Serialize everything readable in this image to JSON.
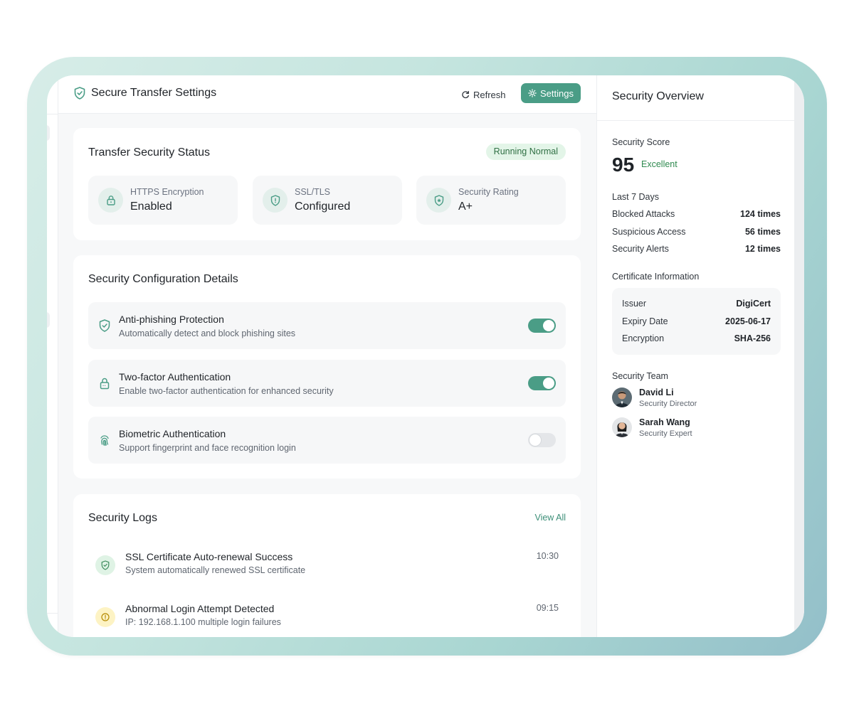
{
  "topbar": {
    "title": "Secure Transfer Settings",
    "refresh_label": "Refresh",
    "settings_label": "Settings"
  },
  "status": {
    "title": "Transfer Security Status",
    "badge": "Running Normal",
    "stats": [
      {
        "label": "HTTPS Encryption",
        "value": "Enabled",
        "icon": "lock-icon"
      },
      {
        "label": "SSL/TLS",
        "value": "Configured",
        "icon": "shield-check-icon"
      },
      {
        "label": "Security Rating",
        "value": "A+",
        "icon": "shield-star-icon"
      }
    ]
  },
  "config": {
    "title": "Security Configuration Details",
    "items": [
      {
        "name": "Anti-phishing Protection",
        "desc": "Automatically detect and block phishing sites",
        "enabled": true,
        "icon": "shield-icon"
      },
      {
        "name": "Two-factor Authentication",
        "desc": "Enable two-factor authentication for enhanced security",
        "enabled": true,
        "icon": "lock-icon"
      },
      {
        "name": "Biometric Authentication",
        "desc": "Support fingerprint and face recognition login",
        "enabled": false,
        "icon": "fingerprint-icon"
      }
    ]
  },
  "logs": {
    "title": "Security Logs",
    "view_all": "View All",
    "items": [
      {
        "title": "SSL Certificate Auto-renewal Success",
        "desc": "System automatically renewed SSL certificate",
        "time": "10:30",
        "type": "success"
      },
      {
        "title": "Abnormal Login Attempt Detected",
        "desc": "IP: 192.168.1.100 multiple login failures",
        "time": "09:15",
        "type": "warning"
      }
    ]
  },
  "overview": {
    "title": "Security Overview",
    "score_label": "Security Score",
    "score": "95",
    "score_tag": "Excellent",
    "period_label": "Last 7 Days",
    "stats": [
      {
        "k": "Blocked Attacks",
        "v": "124 times"
      },
      {
        "k": "Suspicious Access",
        "v": "56 times"
      },
      {
        "k": "Security Alerts",
        "v": "12 times"
      }
    ],
    "cert_label": "Certificate Information",
    "cert": [
      {
        "k": "Issuer",
        "v": "DigiCert"
      },
      {
        "k": "Expiry Date",
        "v": "2025-06-17"
      },
      {
        "k": "Encryption",
        "v": "SHA-256"
      }
    ],
    "team_label": "Security Team",
    "team": [
      {
        "name": "David Li",
        "role": "Security Director"
      },
      {
        "name": "Sarah Wang",
        "role": "Security Expert"
      }
    ]
  },
  "colors": {
    "accent": "#4a9d86",
    "running_badge_bg": "#e3f5e8",
    "excellent": "#2f8a4f",
    "warning_bg": "#fdf3c4"
  }
}
